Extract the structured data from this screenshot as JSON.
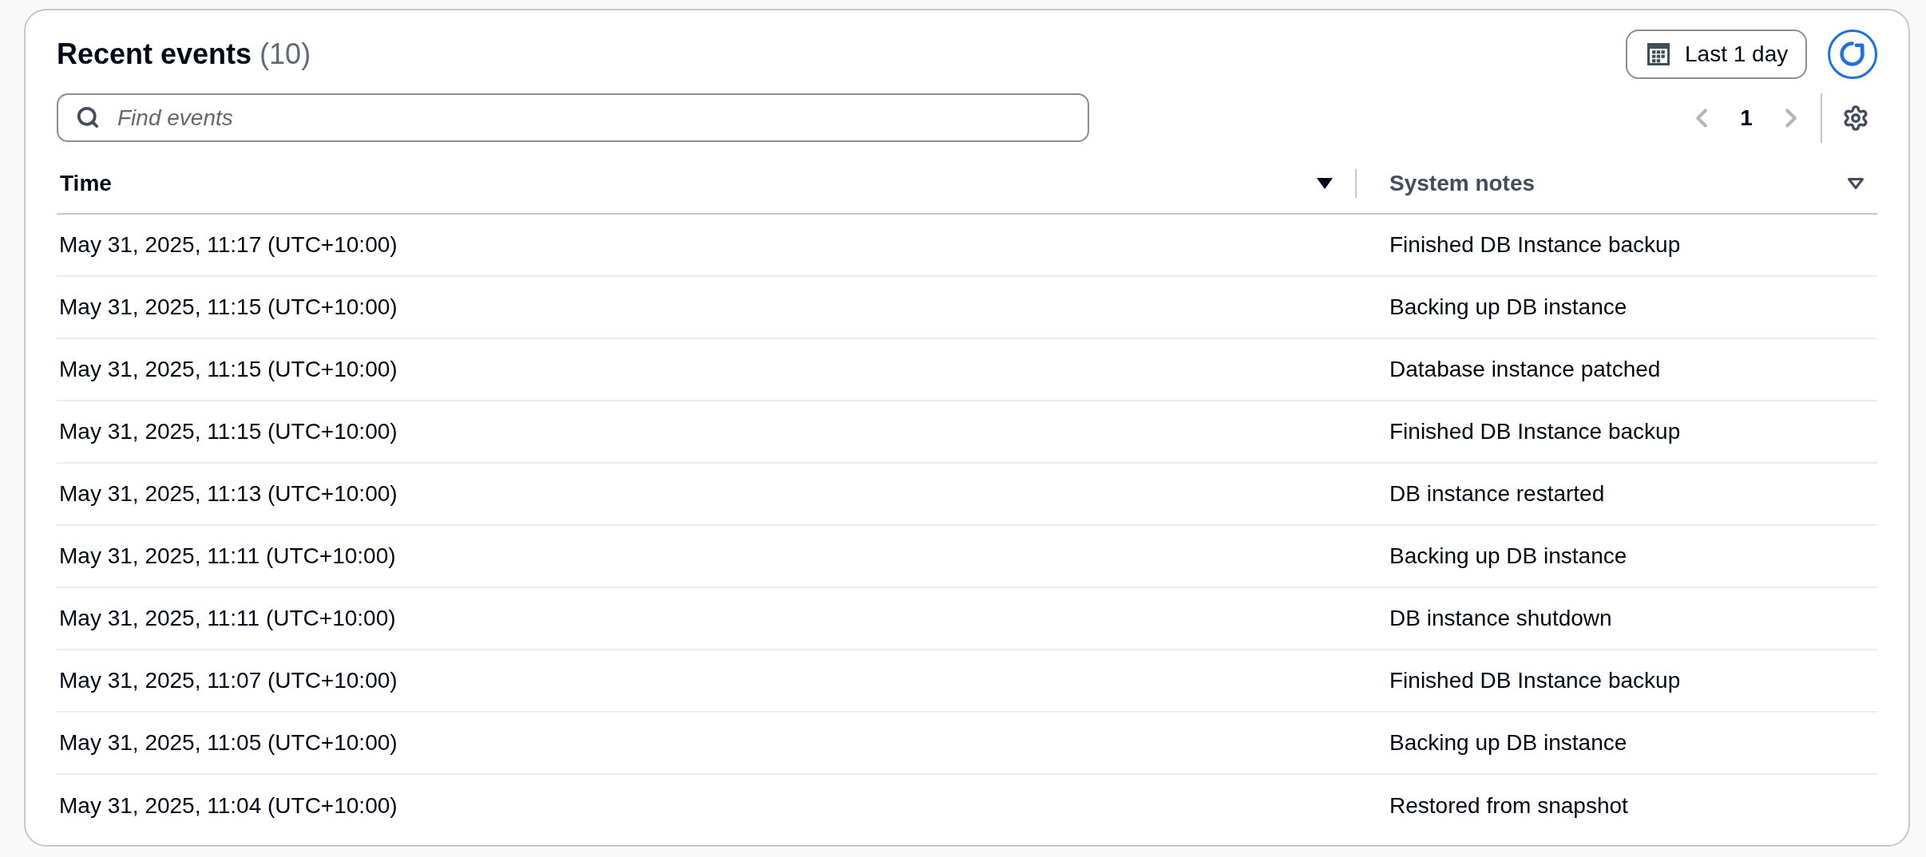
{
  "panel": {
    "title": "Recent events",
    "count": "(10)"
  },
  "date_range": {
    "label": "Last 1 day"
  },
  "search": {
    "placeholder": "Find events"
  },
  "pagination": {
    "previous_disabled": true,
    "pages": [
      {
        "label": "1",
        "selected": true
      }
    ],
    "next_disabled": true
  },
  "table": {
    "columns": [
      {
        "label": "Time",
        "sorted": true
      },
      {
        "label": "System notes",
        "sorted": false
      }
    ],
    "rows": [
      [
        "May 31, 2025, 11:17 (UTC+10:00)",
        "Finished DB Instance backup"
      ],
      [
        "May 31, 2025, 11:15 (UTC+10:00)",
        "Backing up DB instance"
      ],
      [
        "May 31, 2025, 11:15 (UTC+10:00)",
        "Database instance patched"
      ],
      [
        "May 31, 2025, 11:15 (UTC+10:00)",
        "Finished DB Instance backup"
      ],
      [
        "May 31, 2025, 11:13 (UTC+10:00)",
        "DB instance restarted"
      ],
      [
        "May 31, 2025, 11:11 (UTC+10:00)",
        "Backing up DB instance"
      ],
      [
        "May 31, 2025, 11:11 (UTC+10:00)",
        "DB instance shutdown"
      ],
      [
        "May 31, 2025, 11:07 (UTC+10:00)",
        "Finished DB Instance backup"
      ],
      [
        "May 31, 2025, 11:05 (UTC+10:00)",
        "Backing up DB instance"
      ],
      [
        "May 31, 2025, 11:04 (UTC+10:00)",
        "Restored from snapshot"
      ]
    ]
  }
}
